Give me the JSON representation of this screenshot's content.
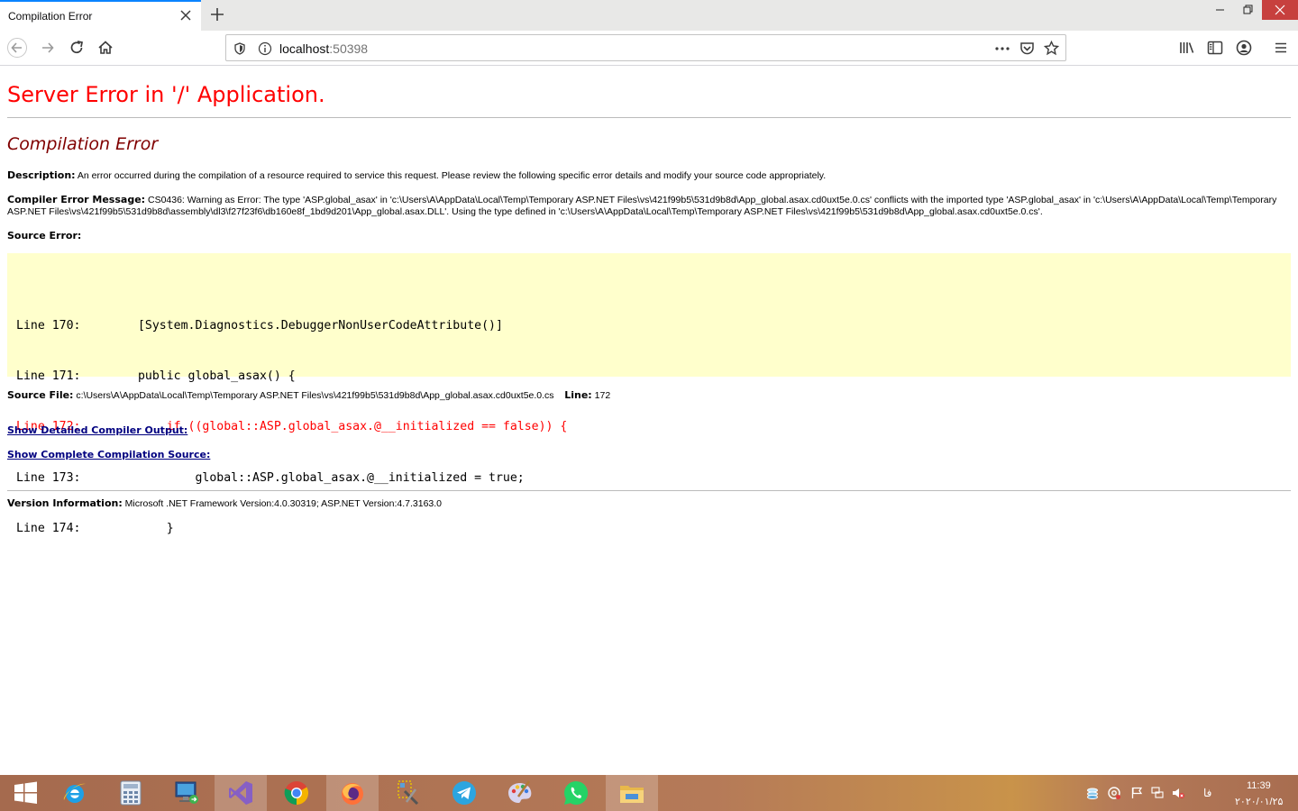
{
  "browser": {
    "tab_title": "Compilation Error",
    "url_host": "localhost",
    "url_port": ":50398"
  },
  "page": {
    "title": "Server Error in '/' Application.",
    "subtitle": "Compilation Error",
    "description_label": "Description:",
    "description_text": "An error occurred during the compilation of a resource required to service this request. Please review the following specific error details and modify your source code appropriately.",
    "compiler_msg_label": "Compiler Error Message:",
    "compiler_msg_text": "CS0436: Warning as Error: The type 'ASP.global_asax' in 'c:\\Users\\A\\AppData\\Local\\Temp\\Temporary ASP.NET Files\\vs\\421f99b5\\531d9b8d\\App_global.asax.cd0uxt5e.0.cs' conflicts with the imported type 'ASP.global_asax' in 'c:\\Users\\A\\AppData\\Local\\Temp\\Temporary ASP.NET Files\\vs\\421f99b5\\531d9b8d\\assembly\\dl3\\f27f23f6\\db160e8f_1bd9d201\\App_global.asax.DLL'. Using the type defined in 'c:\\Users\\A\\AppData\\Local\\Temp\\Temporary ASP.NET Files\\vs\\421f99b5\\531d9b8d\\App_global.asax.cd0uxt5e.0.cs'.",
    "source_error_label": "Source Error:",
    "code_lines": [
      "Line 170:        [System.Diagnostics.DebuggerNonUserCodeAttribute()]",
      "Line 171:        public global_asax() {",
      "Line 172:            if ((global::ASP.global_asax.@__initialized == false)) {",
      "Line 173:                global::ASP.global_asax.@__initialized = true;",
      "Line 174:            }"
    ],
    "source_file_label": "Source File:",
    "source_file_path": "c:\\Users\\A\\AppData\\Local\\Temp\\Temporary ASP.NET Files\\vs\\421f99b5\\531d9b8d\\App_global.asax.cd0uxt5e.0.cs",
    "line_label": "Line:",
    "line_number": "172",
    "link_compiler_output": "Show Detailed Compiler Output:",
    "link_compilation_source": "Show Complete Compilation Source:",
    "version_label": "Version Information:",
    "version_text": "Microsoft .NET Framework Version:4.0.30319; ASP.NET Version:4.7.3163.0"
  },
  "taskbar": {
    "items": [
      "start-icon",
      "internet-explorer-icon",
      "calculator-icon",
      "remote-desktop-icon",
      "visual-studio-icon",
      "chrome-icon",
      "firefox-icon",
      "tools-icon",
      "telegram-icon",
      "paint-icon",
      "whatsapp-icon",
      "file-explorer-icon"
    ],
    "lang": "فا",
    "time": "11:39",
    "date": "۲۰۲۰/۰۱/۲۵"
  },
  "colors": {
    "error_title": "#ff0000",
    "error_subtitle": "#800000",
    "code_bg": "#ffffcc",
    "link": "#000080"
  }
}
